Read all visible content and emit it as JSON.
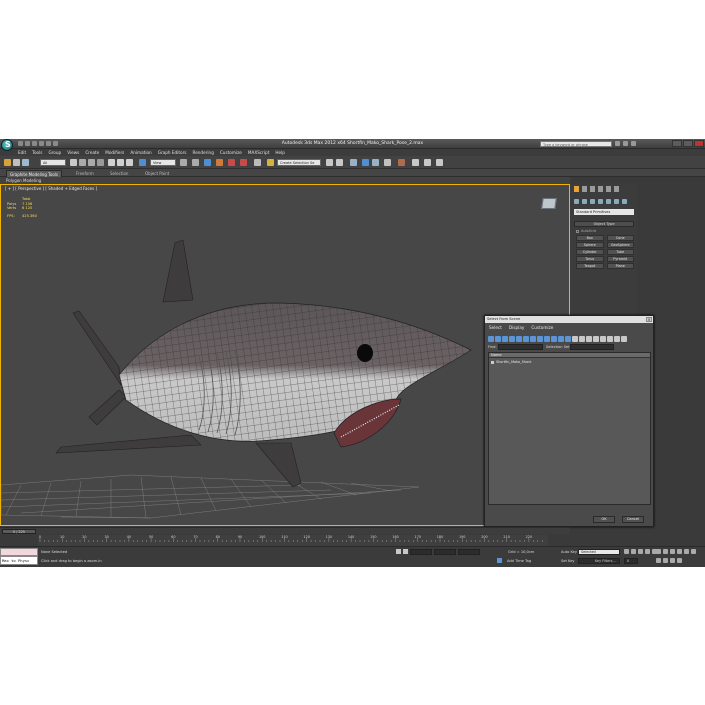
{
  "window": {
    "title": "Autodesk 3ds Max 2012 x64     Shortfin_Mako_Shark_Pose_2.max",
    "search_placeholder": "Type a keyword or phrase"
  },
  "menu": [
    "Edit",
    "Tools",
    "Group",
    "Views",
    "Create",
    "Modifiers",
    "Animation",
    "Graph Editors",
    "Rendering",
    "Customize",
    "MAXScript",
    "Help"
  ],
  "toolbar": {
    "selection_filter": "All",
    "ref_coord": "View",
    "named_selection": "Create Selection Se"
  },
  "ribbon": {
    "tabs": [
      "Graphite Modeling Tools",
      "Freeform",
      "Selection",
      "Object Paint"
    ],
    "active_tab": "Graphite Modeling Tools",
    "sub_label": "Polygon Modeling"
  },
  "viewport": {
    "label": "[ + ] [ Perspective ] [ Shaded + Edged Faces ]",
    "stats_header": "Total",
    "stats": [
      {
        "key": "Polys",
        "value": "7 156"
      },
      {
        "key": "Verts",
        "value": "6 120"
      }
    ],
    "fps_key": "FPS:",
    "fps_value": "425.360"
  },
  "command_panel": {
    "category": "Standard Primitives",
    "object_type_header": "Object Type",
    "autogrid_label": "AutoGrid",
    "object_buttons": [
      "Box",
      "Cone",
      "Sphere",
      "GeoSphere",
      "Cylinder",
      "Tube",
      "Torus",
      "Pyramid",
      "Teapot",
      "Plane"
    ],
    "name_color_header": "Name and Color",
    "object_color": "#a0286e"
  },
  "dialog": {
    "title": "Select From Scene",
    "menu": [
      "Select",
      "Display",
      "Customize"
    ],
    "find_label": "Find:",
    "selection_set_label": "Selection Set:",
    "column_header": "Name",
    "rows": [
      "Shortfin_Mako_Shark"
    ],
    "ok_label": "OK",
    "cancel_label": "Cancel"
  },
  "timeline": {
    "frame_display": "0 / 225",
    "ticks": [
      "0",
      "10",
      "20",
      "30",
      "40",
      "50",
      "60",
      "70",
      "80",
      "90",
      "100",
      "110",
      "120",
      "130",
      "140",
      "150",
      "160",
      "170",
      "180",
      "190",
      "200",
      "210",
      "220"
    ]
  },
  "statusbar": {
    "maxscript_value": "Max to Physc",
    "status": "None Selected",
    "prompt": "Click and drag to begin a zoom-in",
    "grid": "Grid = 10,0cm",
    "add_time_tag": "Add Time Tag",
    "auto_key": "Auto Key",
    "auto_key_mode": "Selected",
    "set_key": "Set Key",
    "key_filters": "Key Filters...",
    "frame_value": "0"
  }
}
